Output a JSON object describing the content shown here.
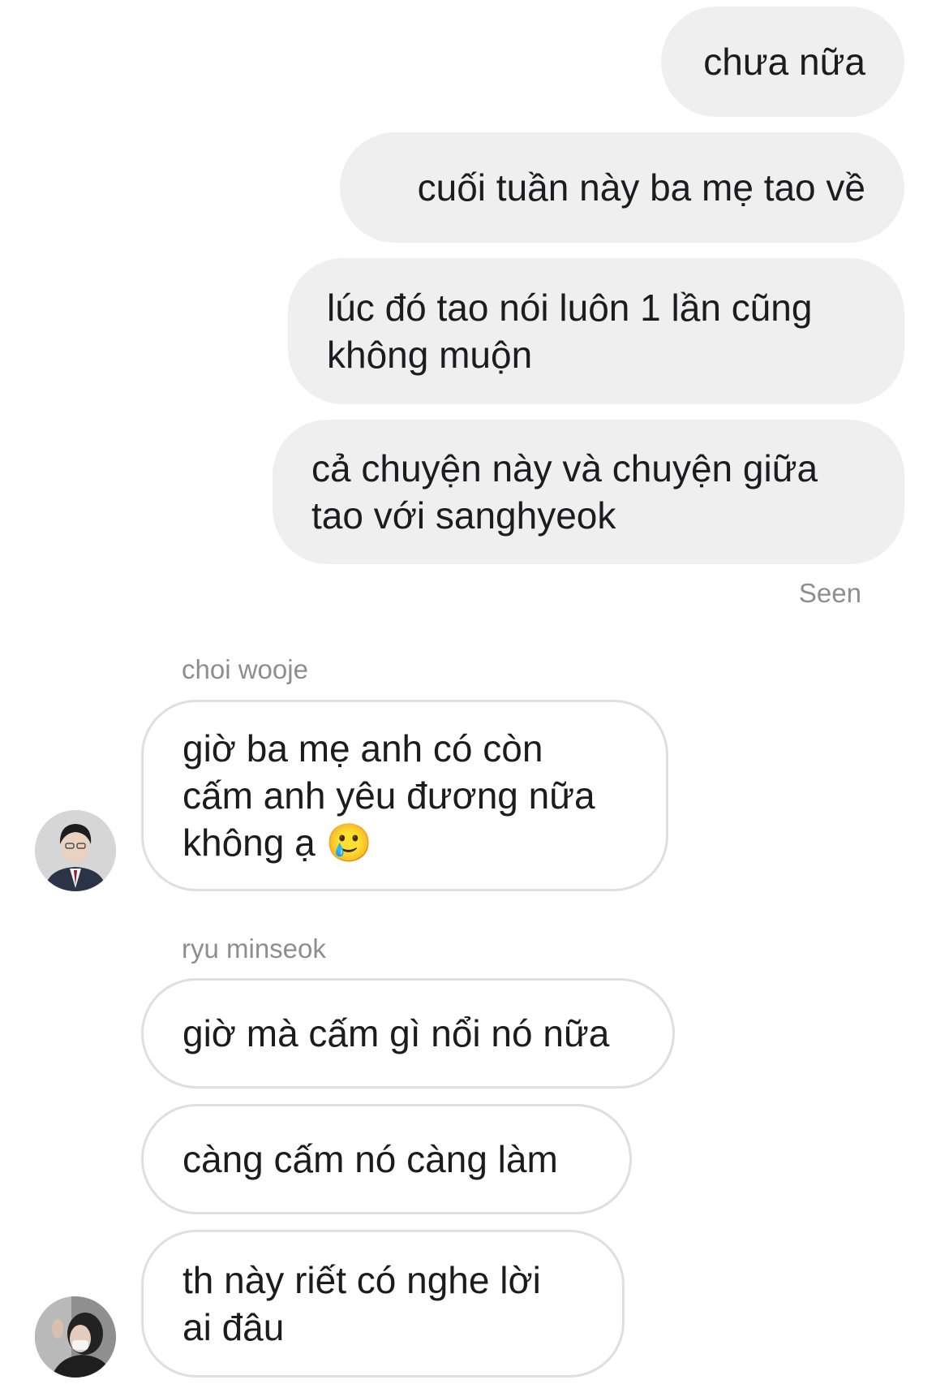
{
  "thread": {
    "outgoing": [
      "chưa nữa",
      "cuối tuần này ba mẹ tao về",
      "lúc đó tao nói luôn 1 lần cũng\nkhông muộn",
      "cả chuyện này và chuyện giữa\ntao với sanghyeok"
    ],
    "seen_label": "Seen",
    "groups": [
      {
        "sender": "choi wooje",
        "avatar_icon": "person-photo-icon",
        "messages": [
          "giờ ba mẹ anh có còn\ncấm anh yêu đương nữa\nkhông ạ 🥲"
        ]
      },
      {
        "sender": "ryu minseok",
        "avatar_icon": "person-photo-icon",
        "messages": [
          "giờ mà cấm gì nổi nó nữa",
          "càng cấm nó càng làm",
          "th này riết có nghe lời\nai đâu"
        ]
      }
    ]
  },
  "colors": {
    "outgoing_bubble": "#efefef",
    "incoming_border": "#dfdfdf",
    "meta_text": "#8e8e8e"
  }
}
